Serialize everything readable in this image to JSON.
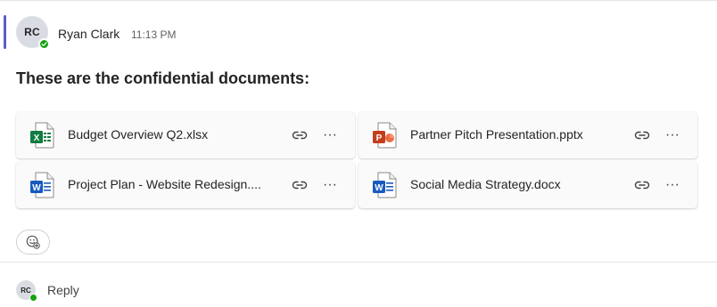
{
  "message": {
    "author_initials": "RC",
    "author_name": "Ryan Clark",
    "timestamp": "11:13 PM",
    "presence": "available",
    "text": "These are the confidential documents:"
  },
  "files": [
    {
      "name": "Budget Overview Q2.xlsx",
      "type": "excel",
      "letter": "X",
      "icon": "excel-file-icon"
    },
    {
      "name": "Partner Pitch Presentation.pptx",
      "type": "powerpoint",
      "letter": "P",
      "icon": "powerpoint-file-icon"
    },
    {
      "name": "Project Plan - Website Redesign....",
      "type": "word",
      "letter": "W",
      "icon": "word-file-icon"
    },
    {
      "name": "Social Media Strategy.docx",
      "type": "word",
      "letter": "W",
      "icon": "word-file-icon"
    }
  ],
  "file_actions": {
    "link_icon": "link-icon",
    "more_label": "···"
  },
  "reaction": {
    "icon": "add-reaction-icon"
  },
  "reply": {
    "avatar_initials": "RC",
    "label": "Reply"
  },
  "colors": {
    "accent": "#5b5fc7",
    "presence_available": "#13a10e",
    "excel": "#107c41",
    "powerpoint": "#c43e1c",
    "word": "#185abd"
  }
}
